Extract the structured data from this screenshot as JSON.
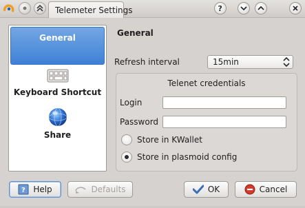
{
  "window": {
    "title": "Telemeter Settings"
  },
  "titlebar": {
    "icons": [
      "kde-icon",
      "minimize-gray-icon",
      "keep-above-icon",
      "help-icon",
      "shade-icon",
      "maximize-icon",
      "close-icon"
    ]
  },
  "sidebar": {
    "items": [
      {
        "label": "General",
        "icon": "general-icon",
        "selected": true
      },
      {
        "label": "Keyboard Shortcut",
        "icon": "keyboard-icon",
        "selected": false
      },
      {
        "label": "Share",
        "icon": "globe-icon",
        "selected": false
      }
    ]
  },
  "main": {
    "title": "General",
    "refresh_label": "Refresh interval",
    "refresh_value": "15min",
    "credentials": {
      "title": "Telenet credentials",
      "login_label": "Login",
      "login_value": "",
      "password_label": "Password",
      "password_value": "",
      "store_kwallet": "Store in KWallet",
      "store_plasmoid": "Store in plasmoid config",
      "selected": "store_plasmoid"
    }
  },
  "buttons": {
    "help": "Help",
    "defaults": "Defaults",
    "ok": "OK",
    "cancel": "Cancel"
  },
  "colors": {
    "selection": "#3f80d6",
    "background": "#d6d2d0",
    "cancel_icon": "#d23a2e",
    "ok_icon": "#3a6db5"
  }
}
